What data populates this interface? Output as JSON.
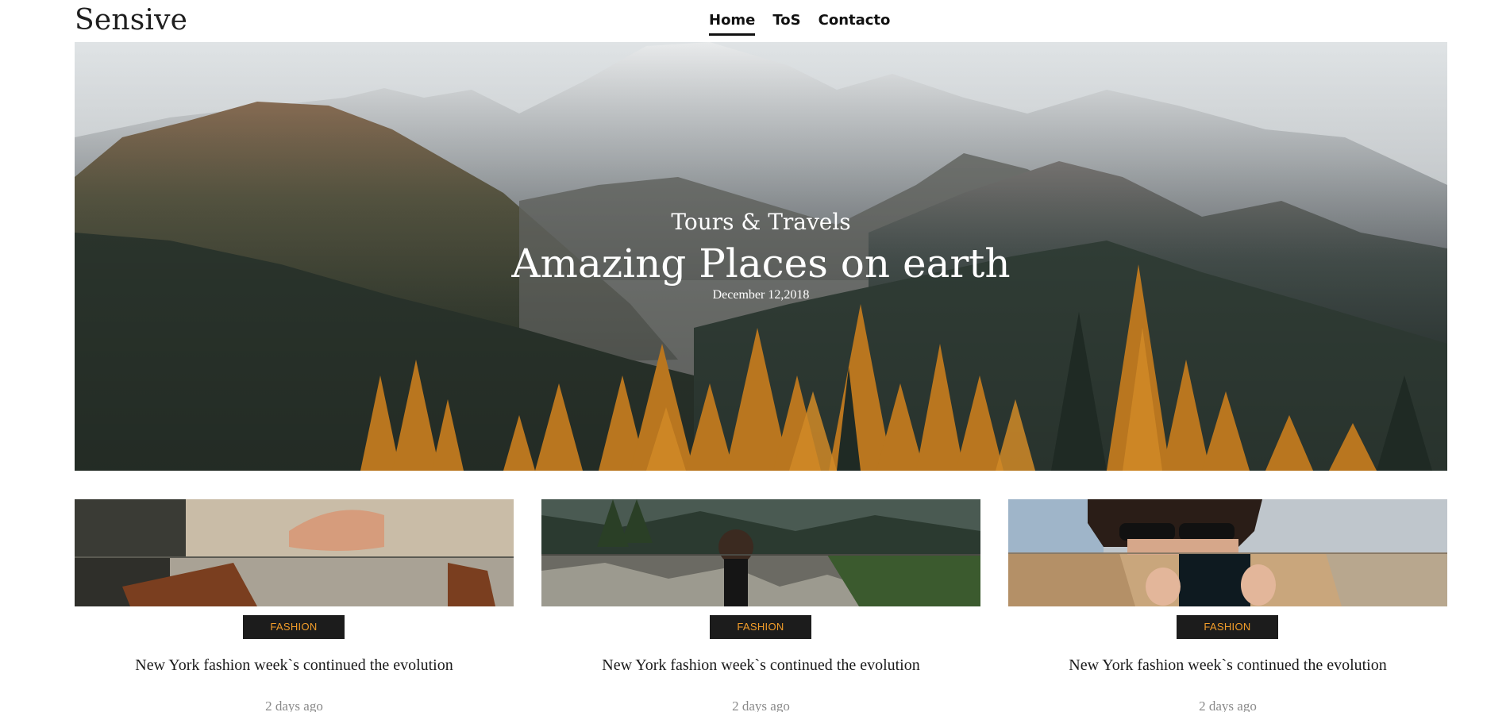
{
  "site": {
    "logo": "Sensive"
  },
  "nav": {
    "items": [
      {
        "label": "Home",
        "active": true
      },
      {
        "label": "ToS",
        "active": false
      },
      {
        "label": "Contacto",
        "active": false
      }
    ]
  },
  "hero": {
    "category": "Tours & Travels",
    "title": "Amazing Places on earth",
    "date": "December 12,2018"
  },
  "cards": [
    {
      "badge": "FASHION",
      "title": "New York fashion week`s continued the evolution",
      "meta": "2 days ago"
    },
    {
      "badge": "FASHION",
      "title": "New York fashion week`s continued the evolution",
      "meta": "2 days ago"
    },
    {
      "badge": "FASHION",
      "title": "New York fashion week`s continued the evolution",
      "meta": "2 days ago"
    }
  ],
  "colors": {
    "badge_bg": "#1c1c1c",
    "badge_text": "#f29d2a",
    "text": "#1d1d1d",
    "meta": "#8a8a8a"
  }
}
